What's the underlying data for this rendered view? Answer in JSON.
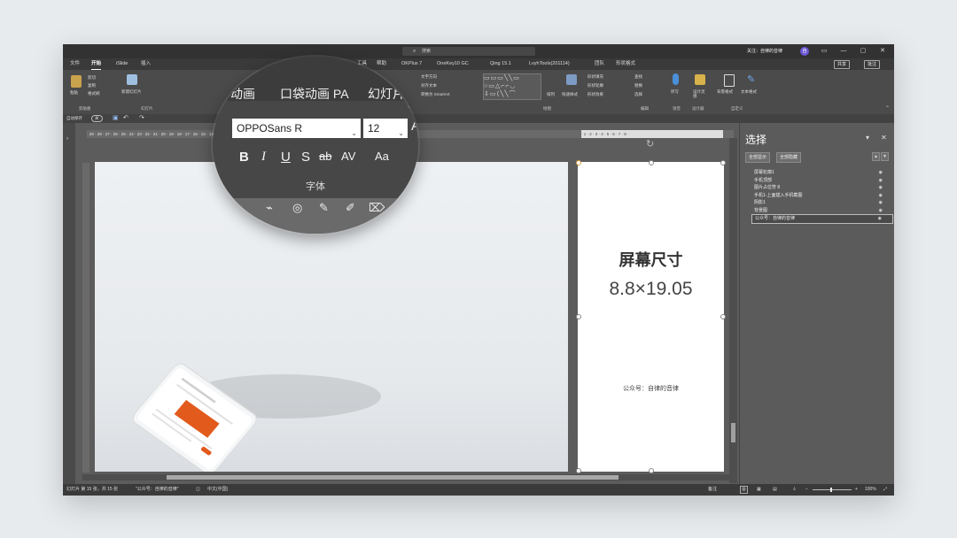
{
  "window": {
    "search_placeholder": "搜索",
    "user_label": "关注：自律的音律",
    "avatar_initial": "自"
  },
  "menu": {
    "tabs": [
      "文件",
      "开始",
      "iSlide",
      "插入",
      "工具",
      "帮助",
      "OKPlus 7",
      "OneKey10 GC",
      "Qing 15.1",
      "LvyhTools(201114)",
      "团队",
      "形状格式"
    ],
    "share_label": "共享",
    "comment_label": "批注"
  },
  "ribbon": {
    "groups": [
      "剪贴板",
      "幻灯片",
      "段落",
      "绘图",
      "编辑",
      "语音",
      "设计器",
      "自定义"
    ],
    "items": {
      "paste": "粘贴",
      "cut": "剪切",
      "copy": "复制",
      "format_painter": "格式刷",
      "new_slide": "新建幻灯片",
      "text_direction": "文字方向",
      "align_text": "对齐文本",
      "smartart": "转换为 SmartArt",
      "arrange": "排列",
      "quick_styles": "快速样式",
      "shape_fill": "形状填充",
      "shape_outline": "形状轮廓",
      "shape_effects": "形状效果",
      "find": "查找",
      "replace": "替换",
      "select": "选择",
      "dictate": "听写",
      "design_ideas": "设计灵感",
      "bg_style": "背景格式",
      "text_style": "文本格式"
    }
  },
  "qat": {
    "autosave": "自动保存",
    "toggle": "关",
    "ref_label": "参考线"
  },
  "magnifier": {
    "tabs": [
      "动画",
      "口袋动画 PA",
      "幻灯片放映"
    ],
    "font_name": "OPPOSans R",
    "font_size": "12",
    "format_buttons": [
      "B",
      "I",
      "U",
      "S",
      "ab",
      "AV",
      "Aa"
    ],
    "group_label": "字体"
  },
  "ruler": {
    "left_ticks": "· 29 · 28 · 27 · 26 · 25 · 24 · 23 · 22 · 21 · 20 · 19 · 18 · 17 · 16 · 15 · 14 · 13 · 12 · 11 · 10 · 9 · 8 · 7 · 6 · 5 · 4 · 3 · 2 · 1 ·",
    "right_ticks": "· 1 · 2 · 3 · 4 · 5 · 6 · 7 · 8 ·"
  },
  "slide": {
    "title": "屏幕尺寸",
    "size": "8.8×19.05",
    "footer": "公众号：自律的音律"
  },
  "selection_pane": {
    "title": "选择",
    "show_all": "全部显示",
    "hide_all": "全部隐藏",
    "items": [
      "屏幕轮廓1",
      "手机顶部",
      "图片占位符 8",
      "手机1-上面插入手机截图",
      "阴影1",
      "背景图",
      "公众号：自律的音律"
    ],
    "selected_index": 6
  },
  "statusbar": {
    "slide_info": "幻灯片 第 15 张，共 15 张",
    "slide_name": "\"公众号：自律的音律\"",
    "language": "中文(中国)",
    "notes": "备注",
    "zoom": "100%"
  },
  "colors": {
    "accent_orange": "#e25a1c",
    "avatar_purple": "#6b57d6"
  }
}
